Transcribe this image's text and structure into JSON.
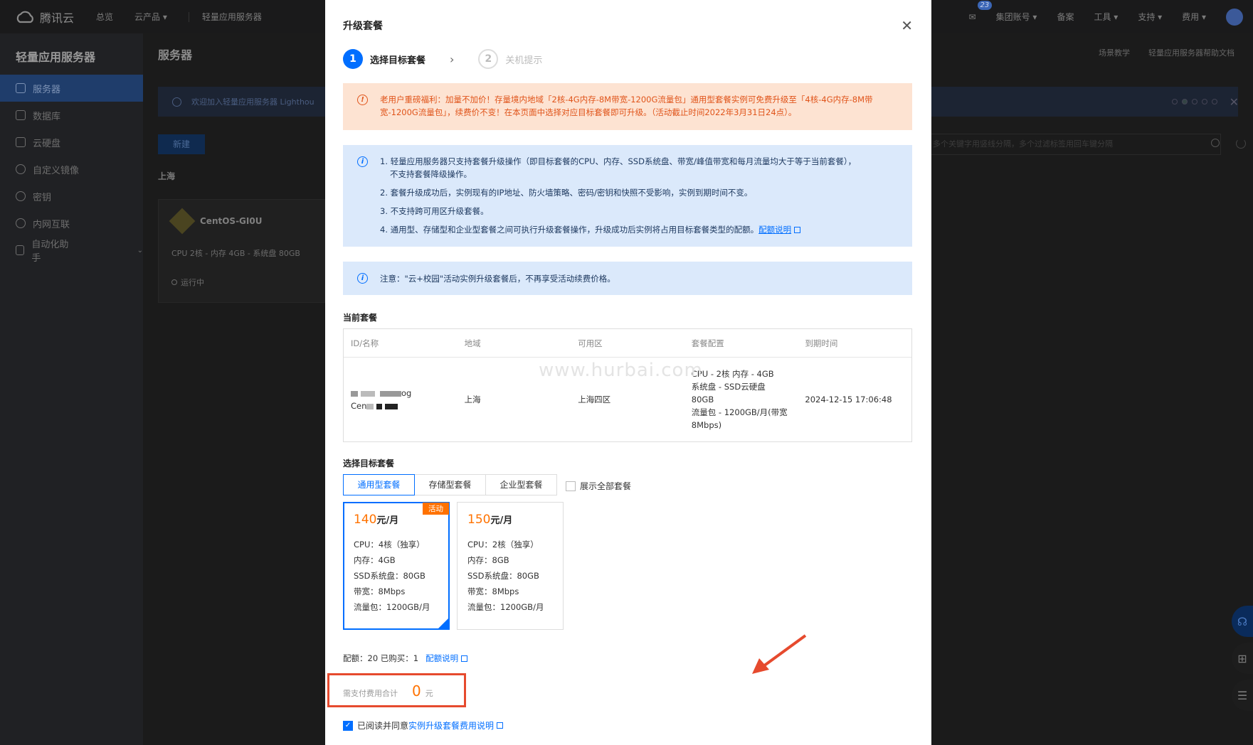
{
  "topbar": {
    "brand": "腾讯云",
    "nav": [
      "总览",
      "云产品 ▾",
      "轻量应用服务器"
    ],
    "right": [
      "集团账号 ▾",
      "备案",
      "工具 ▾",
      "支持 ▾",
      "费用 ▾"
    ],
    "mail_badge": "23"
  },
  "sidebar": {
    "title": "轻量应用服务器",
    "items": [
      {
        "label": "服务器",
        "icon": "server-icon"
      },
      {
        "label": "数据库",
        "icon": "database-icon"
      },
      {
        "label": "云硬盘",
        "icon": "disk-icon"
      },
      {
        "label": "自定义镜像",
        "icon": "image-icon"
      },
      {
        "label": "密钥",
        "icon": "key-icon"
      },
      {
        "label": "内网互联",
        "icon": "network-icon"
      },
      {
        "label": "自动化助手",
        "icon": "automation-icon"
      }
    ]
  },
  "page": {
    "title": "服务器",
    "links": [
      "场景教学",
      "轻量应用服务器帮助文档"
    ],
    "notice": "欢迎加入轻量应用服务器 Lighthou",
    "new_button": "新建",
    "region": "上海",
    "search_placeholder": "多个关键字用竖线分隔，多个过滤标签用回车键分隔",
    "card": {
      "name": "CentOS-GI0U",
      "spec": "CPU 2核 - 内存 4GB - 系统盘 80GB",
      "status": "运行中"
    }
  },
  "modal": {
    "title": "升级套餐",
    "steps": [
      {
        "num": "1",
        "label": "选择目标套餐"
      },
      {
        "num": "2",
        "label": "关机提示"
      }
    ],
    "alert_orange": "老用户重磅福利：加量不加价！存量境内地域「2核-4G内存-8M带宽-1200G流量包」通用型套餐实例可免费升级至「4核-4G内存-8M带宽-1200G流量包」，续费价不变！在本页面中选择对应目标套餐即可升级。（活动截止时间2022年3月31日24点）。",
    "alert_blue": {
      "l1": "1. 轻量应用服务器只支持套餐升级操作（即目标套餐的CPU、内存、SSD系统盘、带宽/峰值带宽和每月流量均大于等于当前套餐），",
      "l1b": "不支持套餐降级操作。",
      "l2": "2. 套餐升级成功后，实例现有的IP地址、防火墙策略、密码/密钥和快照不受影响，实例到期时间不变。",
      "l3": "3. 不支持跨可用区升级套餐。",
      "l4": "4. 通用型、存储型和企业型套餐之间可执行升级套餐操作，升级成功后实例将占用目标套餐类型的配额。",
      "l4_link": "配额说明"
    },
    "alert_note": "注意：\"云+校园\"活动实例升级套餐后，不再享受活动续费价格。",
    "current_title": "当前套餐",
    "table": {
      "headers": [
        "ID/名称",
        "地域",
        "可用区",
        "套餐配置",
        "到期时间"
      ],
      "row": {
        "id_suffix": "og",
        "name_prefix": "Cen",
        "region": "上海",
        "zone": "上海四区",
        "config": [
          "CPU - 2核 内存 - 4GB",
          "系统盘 - SSD云硬盘",
          "80GB",
          "流量包 - 1200GB/月(带宽",
          "8Mbps)"
        ],
        "expire": "2024-12-15 17:06:48"
      }
    },
    "watermark": "www.hurbai.com",
    "target_title": "选择目标套餐",
    "tabs": [
      "通用型套餐",
      "存储型套餐",
      "企业型套餐"
    ],
    "show_all": "展示全部套餐",
    "packages": [
      {
        "price": "140",
        "unit": "元/月",
        "tag": "活动",
        "cpu": "CPU：4核（独享）",
        "mem": "内存：4GB",
        "disk": "SSD系统盘：80GB",
        "bw": "带宽：8Mbps",
        "traffic": "流量包：1200GB/月"
      },
      {
        "price": "150",
        "unit": "元/月",
        "tag": "",
        "cpu": "CPU：2核（独享）",
        "mem": "内存：8GB",
        "disk": "SSD系统盘：80GB",
        "bw": "带宽：8Mbps",
        "traffic": "流量包：1200GB/月"
      }
    ],
    "quota": "配额：20  已购买：1",
    "quota_link": "配额说明",
    "fee_label": "需支付费用合计",
    "fee_amount": "0",
    "fee_unit": "元",
    "agree_text": "已阅读并同意",
    "agree_link": "实例升级套餐费用说明"
  },
  "colors": {
    "accent": "#006eff",
    "price": "#ff7200",
    "highlight": "#e64a2e"
  }
}
